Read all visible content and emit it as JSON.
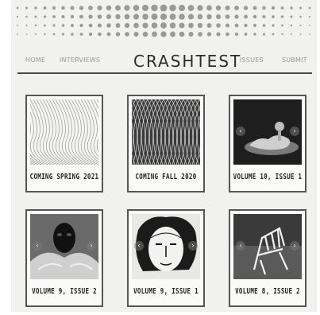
{
  "nav": {
    "home": "HOME",
    "interviews": "INTERVIEWS",
    "logo": "CRASHTEST",
    "issues": "ISSUES",
    "submit": "SUBMIT"
  },
  "cards": [
    {
      "caption": "COMING SPRING 2021"
    },
    {
      "caption": "COMING FALL 2020"
    },
    {
      "caption": "VOLUME 10, ISSUE 1",
      "prev": "‹",
      "next": "›"
    },
    {
      "caption": "VOLUME 9, ISSUE 2",
      "prev": "‹",
      "next": "›"
    },
    {
      "caption": "VOLUME 9, ISSUE 1",
      "prev": "‹",
      "next": "›"
    },
    {
      "caption": "VOLUME 8, ISSUE 2",
      "prev": "‹",
      "next": "›"
    }
  ],
  "colors": {
    "background": "#f1f1ef",
    "rule": "#4a4a4a",
    "dots": "#9a9a9a"
  }
}
